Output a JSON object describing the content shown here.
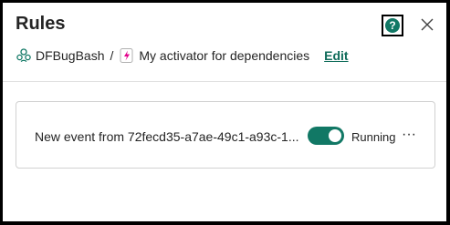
{
  "header": {
    "title": "Rules",
    "help_icon": "help-circle-icon",
    "help_glyph": "?",
    "close_icon": "close-icon"
  },
  "breadcrumb": {
    "workspace_icon": "workspace-icon",
    "workspace": "DFBugBash",
    "separator": "/",
    "item_icon": "activator-icon",
    "item": "My activator for dependencies",
    "edit_label": "Edit"
  },
  "rules": [
    {
      "name": "New event from 72fecd35-a7ae-49c1-a93c-1...",
      "enabled": true,
      "status": "Running",
      "more_icon": "more-icon",
      "more_glyph": "···"
    }
  ],
  "colors": {
    "accent": "#117865",
    "link": "#0f6c5a",
    "activator_pink": "#e3008c"
  }
}
